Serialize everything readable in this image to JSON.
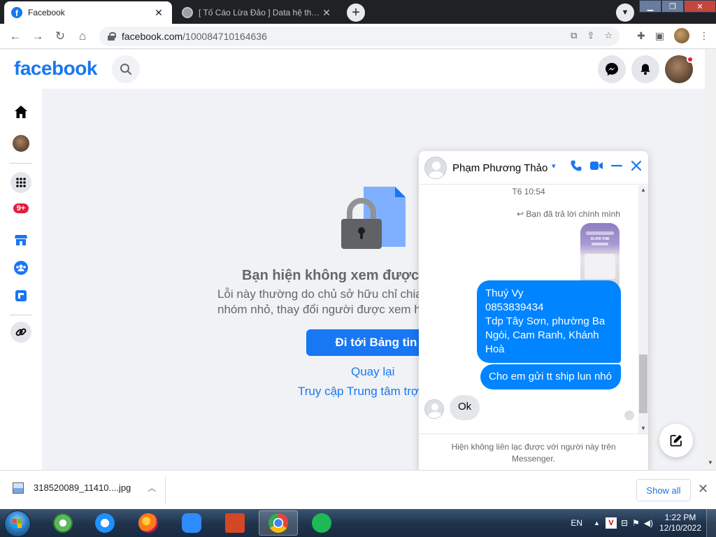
{
  "browser": {
    "tabs": [
      {
        "title": "Facebook",
        "active": true
      },
      {
        "title": "[ Tố Cáo Lừa Đảo ] Data hệ thống",
        "active": false
      }
    ],
    "url_host": "facebook.com",
    "url_path": "/100084710164636"
  },
  "fb": {
    "logo": "facebook",
    "rail_badge": "9+"
  },
  "error": {
    "title": "Bạn hiện không xem được",
    "desc_line1": "Lỗi này thường do chủ sở hữu chỉ chia",
    "desc_line2": "nhóm nhỏ, thay đổi người được xem h",
    "primary_button": "Đi tới Bảng tin",
    "back_link": "Quay lại",
    "help_link": "Truy cập Trung tâm trợ"
  },
  "chat": {
    "name": "Phạm Phương Thảo",
    "time": "T6 10:54",
    "reply_note": "Bạn đã trả lời chính mình",
    "image_text": "30.000 VNĐ",
    "message1_lines": [
      "Thuý Vy",
      "0853839434",
      "Tdp Tây Sơn, phường Ba",
      "Ngòi, Cam Ranh, Khánh",
      "Hoà"
    ],
    "message2": "Cho em gửi tt ship lun nhó",
    "incoming": "Ok",
    "footer": "Hiện không liên lạc được với người này trên Messenger."
  },
  "downloads": {
    "file": "318520089_11410....jpg",
    "show_all": "Show all"
  },
  "taskbar": {
    "lang": "EN",
    "time": "1:22 PM",
    "date": "12/10/2022"
  },
  "colors": {
    "brand": "#1877f2",
    "messenger_bubble": "#0084ff",
    "badge": "#e41e3f"
  }
}
